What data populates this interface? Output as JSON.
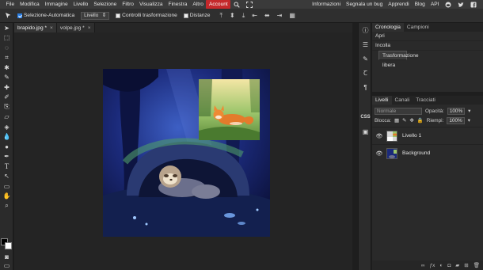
{
  "menu": {
    "items": [
      "File",
      "Modifica",
      "Immagine",
      "Livello",
      "Selezione",
      "Filtro",
      "Visualizza",
      "Finestra",
      "Altro"
    ],
    "account": "Account",
    "right_items": [
      "Informazioni",
      "Segnala un bug",
      "Apprendi",
      "Blog",
      "API"
    ],
    "account_color": "#c5282b"
  },
  "options": {
    "auto_select_label": "Selezione-Automatica",
    "auto_select_checked": true,
    "target_value": "Livello",
    "transform_controls_label": "Controlli trasformazione",
    "distances_label": "Distanze"
  },
  "tabs": [
    {
      "label": "brapido.jpg *",
      "close": "×"
    },
    {
      "label": "volpe.jpg *",
      "close": "×"
    }
  ],
  "history": {
    "tabs": [
      "Cronologia",
      "Campioni"
    ],
    "items": [
      "Apri",
      "Incolla",
      "Trasformazione libera"
    ]
  },
  "layers": {
    "tabs": [
      "Livelli",
      "Canali",
      "Tracciati"
    ],
    "blend_mode": "Normale",
    "opacity_label": "Opacità:",
    "opacity_value": "100%",
    "lock_label": "Blocca:",
    "fill_label": "Riempi:",
    "fill_value": "100%",
    "items": [
      {
        "name": "Livello 1"
      },
      {
        "name": "Background"
      }
    ]
  }
}
